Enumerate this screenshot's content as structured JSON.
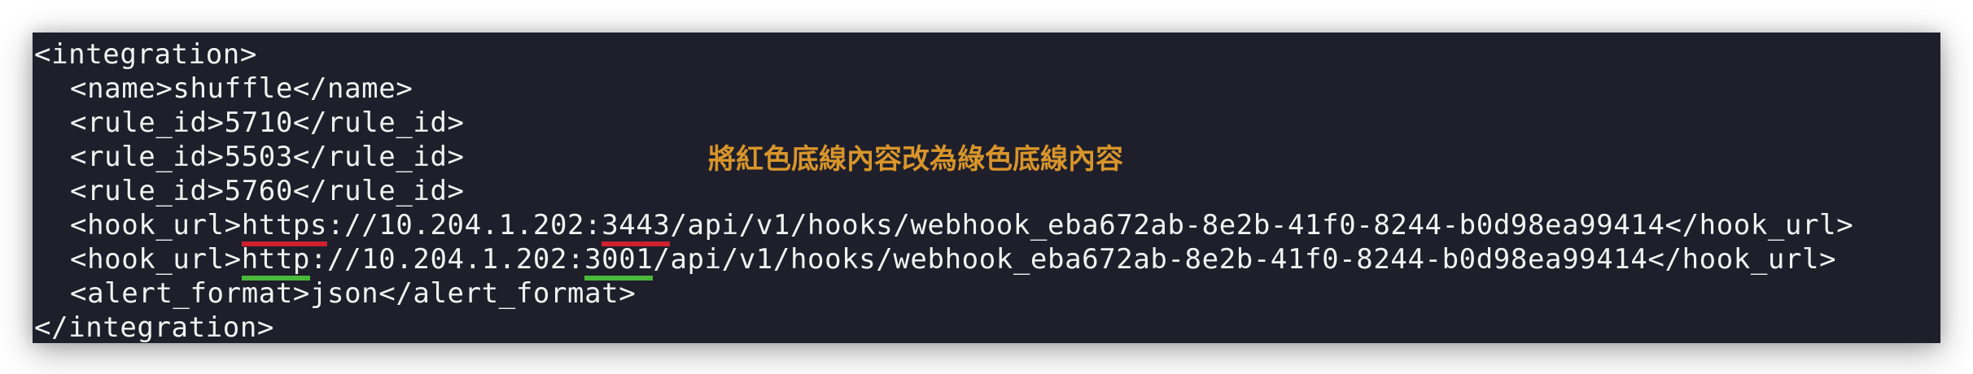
{
  "colors": {
    "background": "#1e1f2b",
    "text": "#f2f2f2",
    "note": "#d9952a",
    "underline_red": "#d0202e",
    "underline_green": "#4ab83a"
  },
  "note": "將紅色底線內容改為綠色底線內容",
  "lines": {
    "l0": "<integration>",
    "l1": "<name>shuffle</name>",
    "l2": "<rule_id>5710</rule_id>",
    "l3": "<rule_id>5503</rule_id>",
    "l4": "<rule_id>5760</rule_id>",
    "l5": {
      "prefix": "<hook_url>",
      "scheme": "https",
      "mid": "://10.204.1.202:",
      "port": "3443",
      "suffix": "/api/v1/hooks/webhook_eba672ab-8e2b-41f0-8244-b0d98ea99414</hook_url>"
    },
    "l6": {
      "prefix": "<hook_url>",
      "scheme": "http",
      "mid": "://10.204.1.202:",
      "port": "3001",
      "suffix": "/api/v1/hooks/webhook_eba672ab-8e2b-41f0-8244-b0d98ea99414</hook_url>"
    },
    "l7": "<alert_format>json</alert_format>",
    "l8": "</integration>"
  }
}
